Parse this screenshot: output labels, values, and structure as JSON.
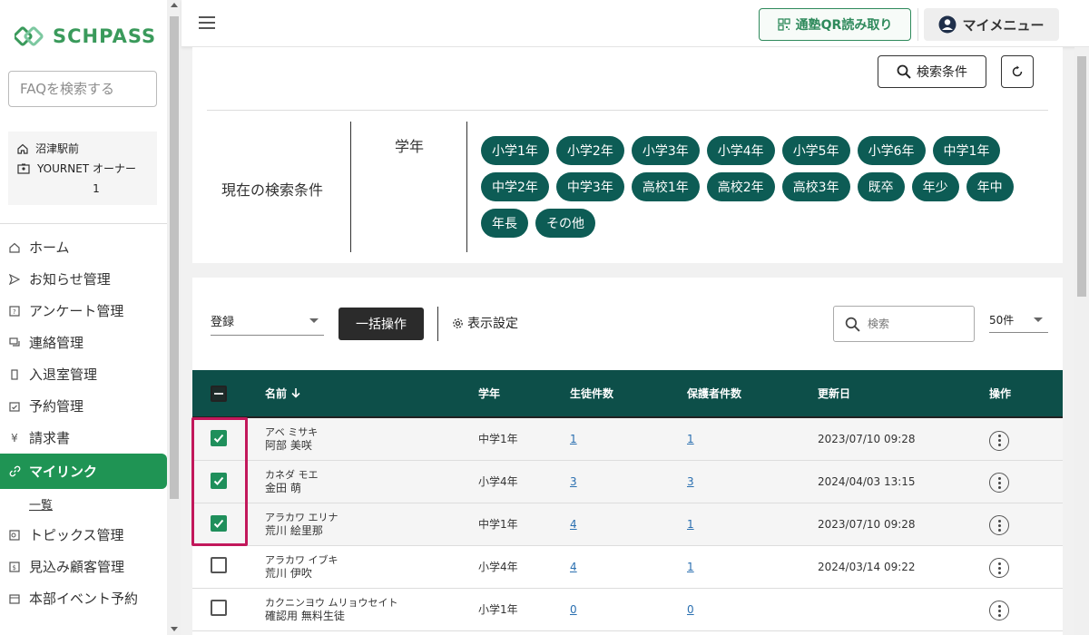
{
  "brand": {
    "name": "SCHPASS",
    "color": "#3a9a5b"
  },
  "sidebar": {
    "faq_placeholder": "FAQを検索する",
    "school": "沼津駅前",
    "user": "YOURNET オーナー",
    "user_num": "1",
    "items": [
      {
        "label": "ホーム",
        "icon": "home-icon"
      },
      {
        "label": "お知らせ管理",
        "icon": "send-icon"
      },
      {
        "label": "アンケート管理",
        "icon": "survey-icon"
      },
      {
        "label": "連絡管理",
        "icon": "chat-icon"
      },
      {
        "label": "入退室管理",
        "icon": "door-icon"
      },
      {
        "label": "予約管理",
        "icon": "calendar-check-icon"
      },
      {
        "label": "請求書",
        "icon": "yen-icon"
      },
      {
        "label": "マイリンク",
        "icon": "link-icon",
        "active": true
      },
      {
        "label": "トピックス管理",
        "icon": "topics-icon"
      },
      {
        "label": "見込み顧客管理",
        "icon": "prospect-icon"
      },
      {
        "label": "本部イベント予約",
        "icon": "calendar-icon"
      }
    ],
    "submenu_label": "一覧"
  },
  "header": {
    "qr_label": "通塾QR読み取り",
    "mymenu_label": "マイメニュー"
  },
  "filter": {
    "search_button": "検索条件",
    "current_label": "現在の検索条件",
    "grade_label": "学年",
    "grades": [
      "小学1年",
      "小学2年",
      "小学3年",
      "小学4年",
      "小学5年",
      "小学6年",
      "中学1年",
      "中学2年",
      "中学3年",
      "高校1年",
      "高校2年",
      "高校3年",
      "既卒",
      "年少",
      "年中",
      "年長",
      "その他"
    ]
  },
  "list": {
    "register_select": "登録",
    "bulk_button": "一括操作",
    "display_settings": "表示設定",
    "search_placeholder": "検索",
    "per_page": "50件",
    "columns": {
      "name": "名前",
      "grade": "学年",
      "students": "生徒件数",
      "guardians": "保護者件数",
      "updated": "更新日",
      "actions": "操作"
    },
    "rows": [
      {
        "kana": "アベ ミサキ",
        "kanji": "阿部 美咲",
        "grade": "中学1年",
        "students": "1",
        "guardians": "1",
        "updated": "2023/07/10 09:28",
        "checked": true
      },
      {
        "kana": "カネダ モエ",
        "kanji": "金田 萌",
        "grade": "小学4年",
        "students": "3",
        "guardians": "3",
        "updated": "2024/04/03 13:15",
        "checked": true
      },
      {
        "kana": "アラカワ エリナ",
        "kanji": "荒川 絵里那",
        "grade": "中学1年",
        "students": "4",
        "guardians": "1",
        "updated": "2023/07/10 09:28",
        "checked": true
      },
      {
        "kana": "アラカワ イブキ",
        "kanji": "荒川 伊吹",
        "grade": "小学4年",
        "students": "4",
        "guardians": "1",
        "updated": "2024/03/14 09:22",
        "checked": false
      },
      {
        "kana": "カクニンヨウ ムリョウセイト",
        "kanji": "確認用 無料生徒",
        "grade": "小学1年",
        "students": "0",
        "guardians": "0",
        "updated": "",
        "checked": false
      }
    ]
  },
  "colors": {
    "accent": "#1f9454",
    "table_header": "#0d4f49",
    "chip": "#0d5c55",
    "highlight": "#c2185b"
  }
}
